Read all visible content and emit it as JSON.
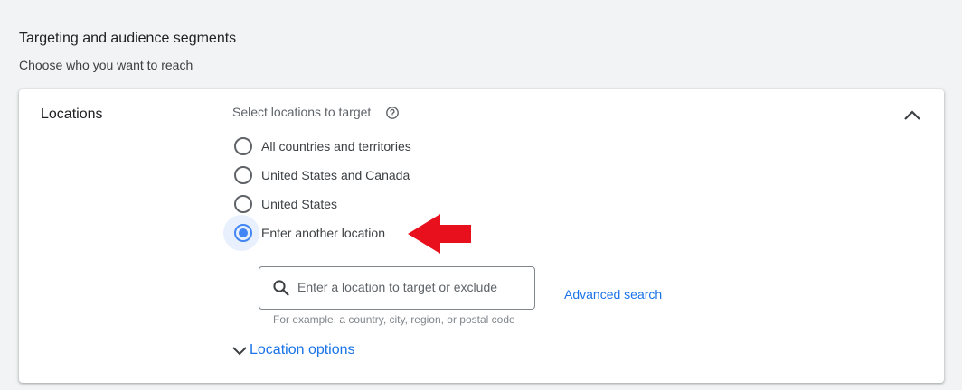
{
  "section": {
    "title": "Targeting and audience segments",
    "subtitle": "Choose who you want to reach"
  },
  "card": {
    "label": "Locations",
    "collapse_icon": "chevron-up-icon",
    "select_label": "Select locations to target",
    "help_icon": "help-circle-icon",
    "options": [
      {
        "label": "All countries and territories",
        "checked": false
      },
      {
        "label": "United States and Canada",
        "checked": false
      },
      {
        "label": "United States",
        "checked": false
      },
      {
        "label": "Enter another location",
        "checked": true
      }
    ],
    "search": {
      "icon": "search-icon",
      "value": "",
      "placeholder": "Enter a location to target or exclude",
      "hint": "For example, a country, city, region, or postal code"
    },
    "advanced_search": "Advanced search",
    "location_options": "Location options"
  },
  "colors": {
    "accent": "#1a73e8",
    "radio_checked": "#4285f4",
    "annotation_arrow": "#e8101c"
  }
}
